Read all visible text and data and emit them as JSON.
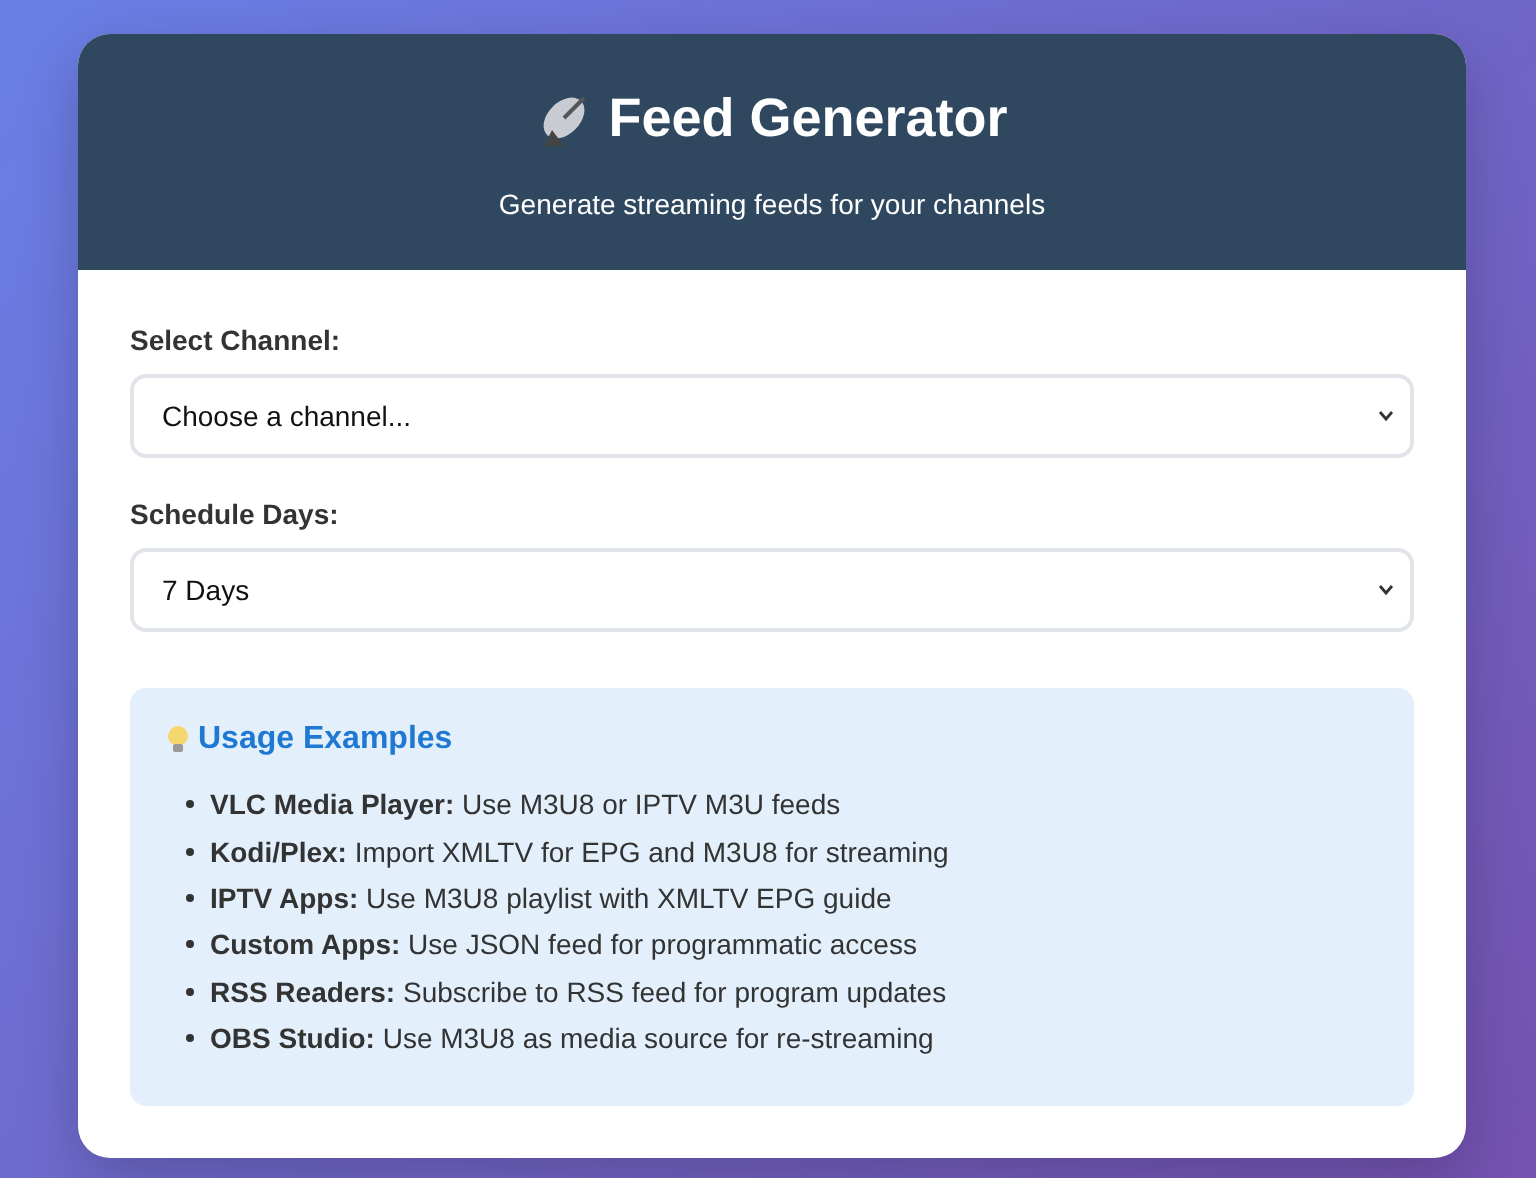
{
  "header": {
    "title": "Feed Generator",
    "subtitle": "Generate streaming feeds for your channels"
  },
  "fields": [
    {
      "label": "Select Channel:",
      "value": "Choose a channel..."
    },
    {
      "label": "Schedule Days:",
      "value": "7 Days"
    }
  ],
  "usage": {
    "title": "Usage Examples",
    "items": [
      "**VLC Media Player:** Use M3U8 or IPTV M3U feeds",
      "**Kodi/Plex:** Import XMLTV for EPG and M3U8 for streaming",
      "**IPTV Apps:** Use M3U8 playlist with XMLTV EPG guide",
      "**Custom Apps:** Use JSON feed for programmatic access",
      "**RSS Readers:** Subscribe to RSS feed for program updates",
      "**OBS Studio:** Use M3U8 as media source for re-streaming"
    ]
  }
}
